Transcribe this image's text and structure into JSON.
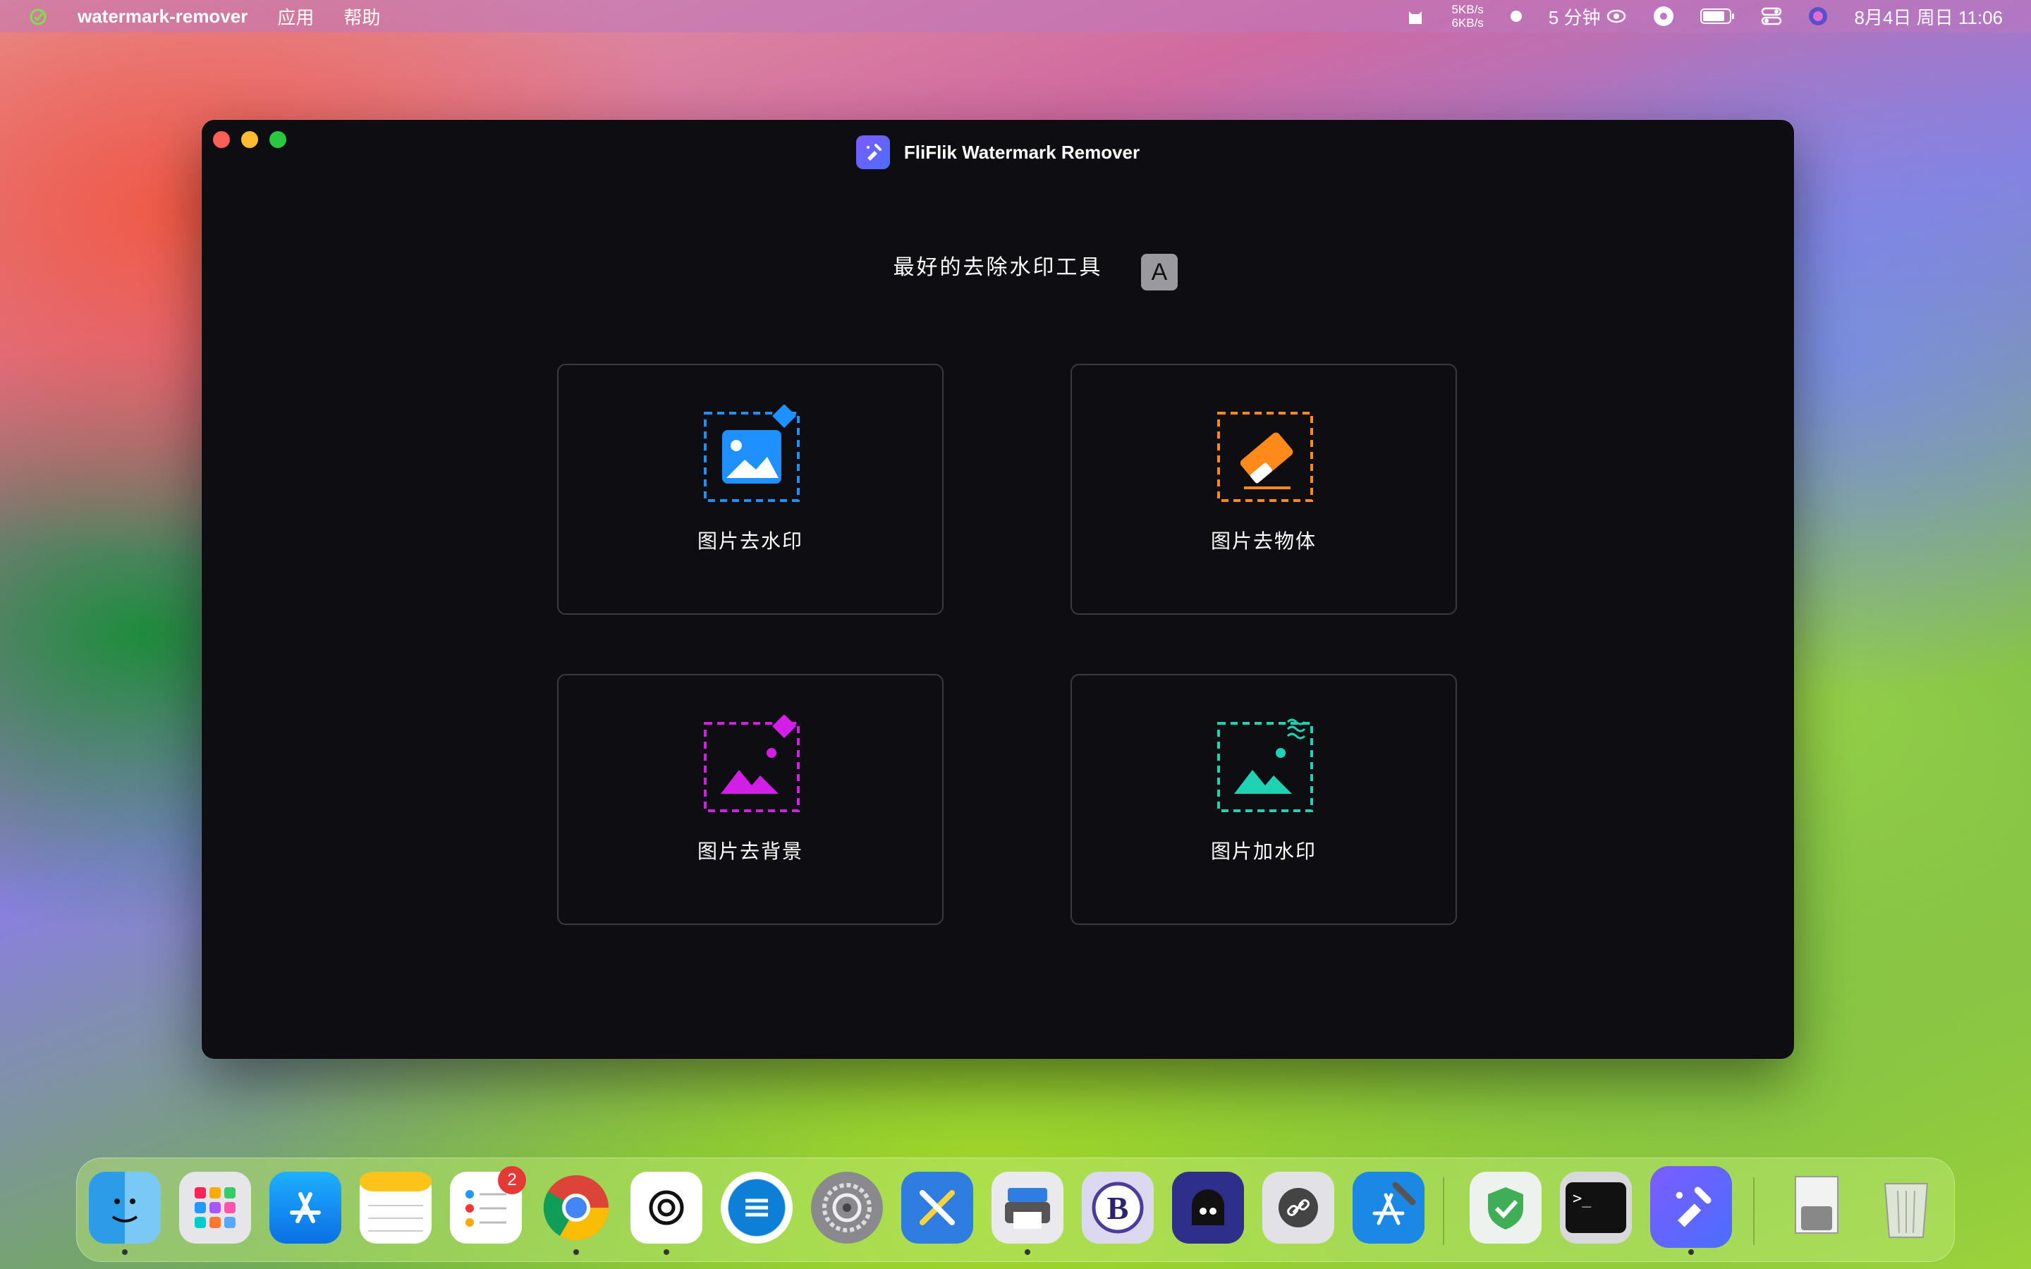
{
  "menubar": {
    "app_name": "watermark-remover",
    "menus": [
      "应用",
      "帮助"
    ],
    "net_up": "5KB/s",
    "net_down": "6KB/s",
    "timer": "5 分钟",
    "datetime": "8月4日 周日  11:06"
  },
  "window": {
    "title": "FliFlik Watermark Remover",
    "subtitle": "最好的去除水印工具",
    "lang_button": "A",
    "cards": [
      {
        "label": "图片去水印",
        "icon": "image-watermark-icon",
        "color": "#1e90ff"
      },
      {
        "label": "图片去物体",
        "icon": "eraser-icon",
        "color": "#ff8a1a"
      },
      {
        "label": "图片去背景",
        "icon": "background-remove-icon",
        "color": "#d21ee6"
      },
      {
        "label": "图片加水印",
        "icon": "add-watermark-icon",
        "color": "#1ed2b4"
      }
    ]
  },
  "dock": {
    "apps": [
      {
        "name": "finder-icon"
      },
      {
        "name": "launchpad-icon"
      },
      {
        "name": "app-store-icon"
      },
      {
        "name": "notes-icon"
      },
      {
        "name": "reminders-icon",
        "badge": "2"
      },
      {
        "name": "chrome-icon"
      },
      {
        "name": "chatgpt-icon"
      },
      {
        "name": "text-app-icon"
      },
      {
        "name": "system-settings-icon"
      },
      {
        "name": "xcode-tools-icon"
      },
      {
        "name": "printer-app-icon"
      },
      {
        "name": "bbedit-icon"
      },
      {
        "name": "ghost-app-icon"
      },
      {
        "name": "link-app-icon"
      },
      {
        "name": "xcode-icon"
      },
      {
        "name": "shield-app-icon"
      },
      {
        "name": "terminal-icon"
      },
      {
        "name": "watermark-remover-icon"
      },
      {
        "name": "archive-icon"
      },
      {
        "name": "trash-icon"
      }
    ]
  }
}
